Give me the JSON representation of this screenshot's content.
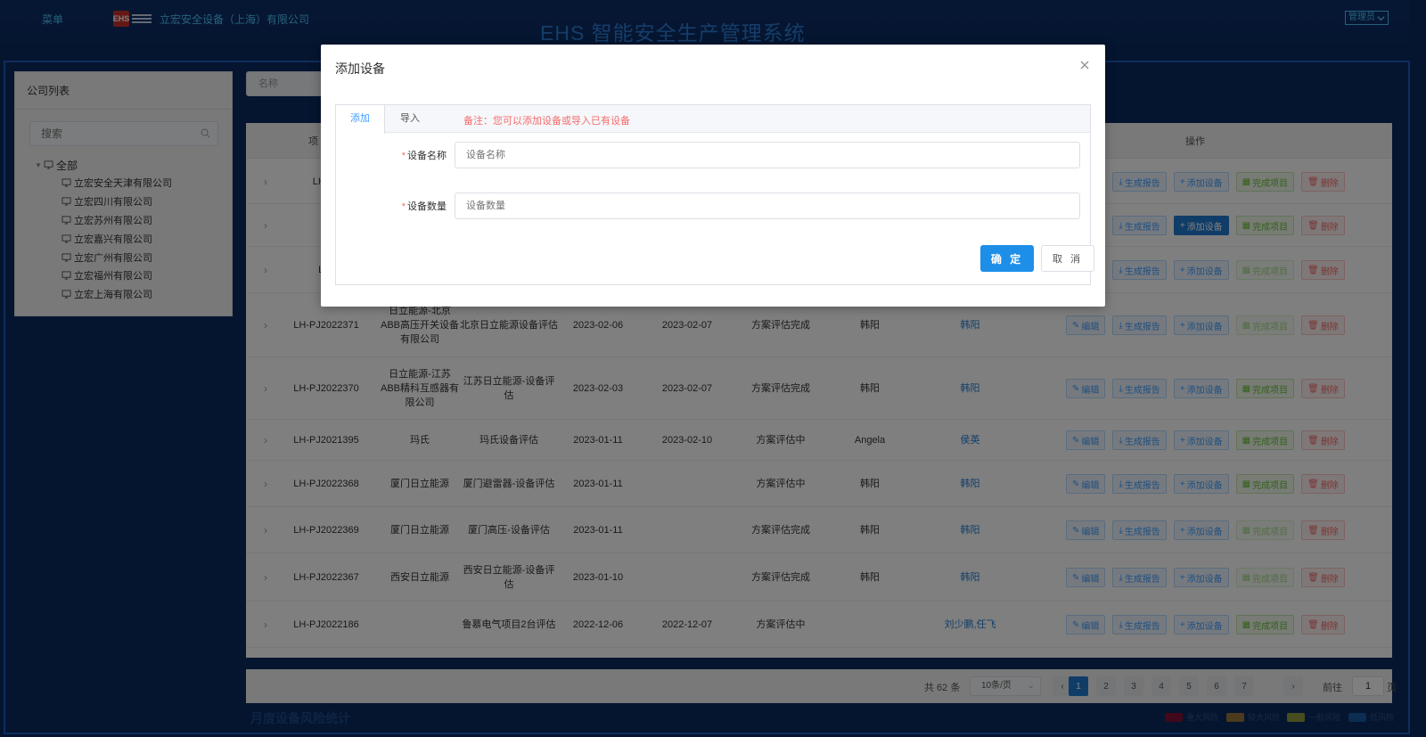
{
  "header": {
    "menu": "菜单",
    "logo_text": "EHS",
    "company": "立宏安全设备（上海）有限公司",
    "system_title": "EHS 智能安全生产管理系统",
    "admin": "管理员"
  },
  "company_panel": {
    "title": "公司列表",
    "search_placeholder": "搜索",
    "root": "全部",
    "companies": [
      "立宏安全天津有限公司",
      "立宏四川有限公司",
      "立宏苏州有限公司",
      "立宏嘉兴有限公司",
      "立宏广州有限公司",
      "立宏福州有限公司",
      "立宏上海有限公司"
    ]
  },
  "filter": {
    "name_placeholder": "名称"
  },
  "table": {
    "headers": {
      "code": "项",
      "ops": "操作"
    },
    "ops_labels": {
      "edit": "编辑",
      "report": "生成报告",
      "add_device": "添加设备",
      "complete": "完成项目",
      "delete": "删除"
    },
    "rows": [
      {
        "code": "LH-PJ",
        "cname": "",
        "pname": "",
        "start": "",
        "end": "",
        "status": "",
        "mgr": "",
        "owner": ""
      },
      {
        "code": "",
        "cname": "",
        "pname": "",
        "start": "",
        "end": "",
        "status": "",
        "mgr": "",
        "owner": ""
      },
      {
        "code": "LH-",
        "cname": "",
        "pname": "",
        "start": "",
        "end": "",
        "status": "",
        "mgr": "",
        "owner": ""
      },
      {
        "code": "LH-PJ2022371",
        "cname": "日立能源-北京ABB高压开关设备有限公司",
        "pname": "北京日立能源设备评估",
        "start": "2023-02-06",
        "end": "2023-02-07",
        "status": "方案评估完成",
        "mgr": "韩阳",
        "owner": "韩阳"
      },
      {
        "code": "LH-PJ2022370",
        "cname": "日立能源-江苏ABB精科互感器有限公司",
        "pname": "江苏日立能源-设备评估",
        "start": "2023-02-03",
        "end": "2023-02-07",
        "status": "方案评估完成",
        "mgr": "韩阳",
        "owner": "韩阳"
      },
      {
        "code": "LH-PJ2021395",
        "cname": "玛氏",
        "pname": "玛氏设备评估",
        "start": "2023-01-11",
        "end": "2023-02-10",
        "status": "方案评估中",
        "mgr": "Angela",
        "owner": "侯英"
      },
      {
        "code": "LH-PJ2022368",
        "cname": "厦门日立能源",
        "pname": "厦门避雷器-设备评估",
        "start": "2023-01-11",
        "end": "",
        "status": "方案评估中",
        "mgr": "韩阳",
        "owner": "韩阳"
      },
      {
        "code": "LH-PJ2022369",
        "cname": "厦门日立能源",
        "pname": "厦门高压-设备评估",
        "start": "2023-01-11",
        "end": "",
        "status": "方案评估完成",
        "mgr": "韩阳",
        "owner": "韩阳"
      },
      {
        "code": "LH-PJ2022367",
        "cname": "西安日立能源",
        "pname": "西安日立能源-设备评估",
        "start": "2023-01-10",
        "end": "",
        "status": "方案评估完成",
        "mgr": "韩阳",
        "owner": "韩阳"
      },
      {
        "code": "LH-PJ2022186",
        "cname": "",
        "pname": "鲁慕电气项目2台评估",
        "start": "2022-12-06",
        "end": "2022-12-07",
        "status": "方案评估中",
        "mgr": "",
        "owner": "刘少鹏,任飞"
      }
    ]
  },
  "pagination": {
    "total": "共 62 条",
    "page_size": "10条/页",
    "prev": "‹",
    "pages": [
      "1",
      "2",
      "3",
      "4",
      "5",
      "6",
      "7"
    ],
    "next": "›",
    "goto": "前往",
    "jump_value": "1",
    "unit": "页",
    "active_page": "1"
  },
  "stats": {
    "title": "月度设备风险统计",
    "legend": [
      {
        "label": "重大风险",
        "color": "#d0021b"
      },
      {
        "label": "较大风险",
        "color": "#f5a623"
      },
      {
        "label": "一般风险",
        "color": "#e6e62c"
      },
      {
        "label": "低风险",
        "color": "#1e7bd0"
      }
    ]
  },
  "modal": {
    "title": "添加设备",
    "tabs": {
      "add": "添加",
      "import": "导入"
    },
    "note": "备注：您可以添加设备或导入已有设备",
    "fields": {
      "name_label": "设备名称",
      "name_placeholder": "设备名称",
      "qty_label": "设备数量",
      "qty_placeholder": "设备数量"
    },
    "confirm": "确 定",
    "cancel": "取 消"
  },
  "colors": {
    "primary": "#1e8fe8",
    "danger": "#f56c6c",
    "success": "#67c23a",
    "background": "#0a2a5e"
  }
}
